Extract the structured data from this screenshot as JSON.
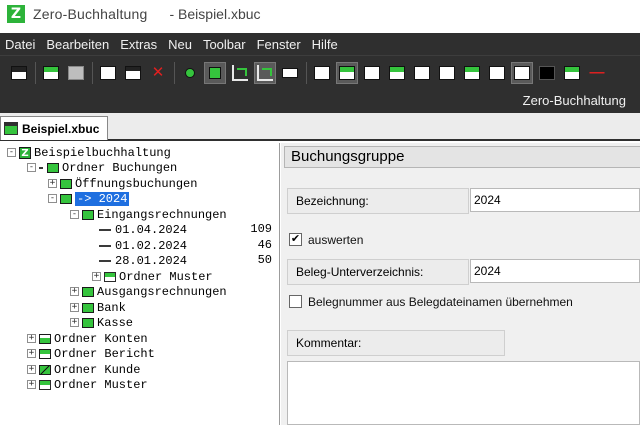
{
  "window": {
    "app_name": "Zero-Buchhaltung",
    "document_name": "- Beispiel.xbuc",
    "logo_letter": "Z"
  },
  "menu": [
    "Datei",
    "Bearbeiten",
    "Extras",
    "Neu",
    "Toolbar",
    "Fenster",
    "Hilfe"
  ],
  "brand_label": "Zero-Buchhaltung",
  "tab": {
    "label": "Beispiel.xbuc"
  },
  "tree": {
    "root": "Beispielbuchhaltung",
    "ordner_buchungen": "Ordner Buchungen",
    "oeffnungsbuchungen": "Öffnungsbuchungen",
    "selected_group": "-> 2024",
    "eingangsrechnungen": "Eingangsrechnungen",
    "entries": [
      {
        "date": "01.04.2024",
        "amount": "109"
      },
      {
        "date": "01.02.2024",
        "amount": "46"
      },
      {
        "date": "28.01.2024",
        "amount": "50"
      }
    ],
    "ordner_muster_inner": "Ordner Muster",
    "ausgangsrechnungen": "Ausgangsrechnungen",
    "bank": "Bank",
    "kasse": "Kasse",
    "ordner_konten": "Ordner Konten",
    "ordner_bericht": "Ordner Bericht",
    "ordner_kunde": "Ordner Kunde",
    "ordner_muster": "Ordner Muster",
    "expand_plus": "+",
    "expand_minus": "-"
  },
  "detail": {
    "title": "Buchungsgruppe",
    "bezeichnung_label": "Bezeichnung:",
    "bezeichnung_value": "2024",
    "auswerten_label": "auswerten",
    "auswerten_checked": true,
    "check_mark": "✔",
    "beleg_label": "Beleg-Unterverzeichnis:",
    "beleg_value": "2024",
    "belegnummer_label": "Belegnummer aus Belegdateinamen übernehmen",
    "belegnummer_checked": false,
    "kommentar_label": "Kommentar:"
  },
  "colors": {
    "accent_green": "#35c43d",
    "selection_blue": "#1e6fe0",
    "dark_chrome": "#2f2f2f"
  }
}
